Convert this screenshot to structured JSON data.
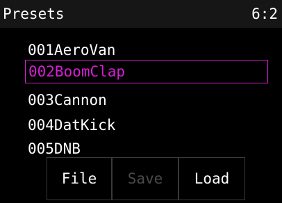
{
  "header": {
    "title": "Presets",
    "counter": "6:2"
  },
  "presets": {
    "items": [
      {
        "label": "001AeroVan",
        "selected": false
      },
      {
        "label": "002BoomClap",
        "selected": true
      },
      {
        "label": "003Cannon",
        "selected": false
      },
      {
        "label": "004DatKick",
        "selected": false
      },
      {
        "label": "005DNB",
        "selected": false
      }
    ]
  },
  "toolbar": {
    "file_label": "File",
    "save_label": "Save",
    "load_label": "Load",
    "save_enabled": false
  },
  "colors": {
    "background": "#000000",
    "titlebar": "#161616",
    "text": "#ffffff",
    "selection": "#d81ed6",
    "disabled_text": "#4a4a4a",
    "button_border": "#3a3a3a"
  }
}
